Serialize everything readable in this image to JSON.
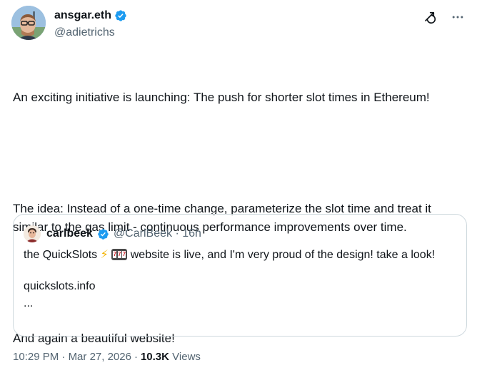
{
  "author": {
    "display_name": "ansgar.eth",
    "handle": "@adietrichs",
    "verified": true,
    "verified_color": "#1d9bf0"
  },
  "actions": {
    "grok_icon": "grok-icon",
    "more_icon": "more-icon"
  },
  "tweet": {
    "paragraphs": [
      "An exciting initiative is launching: The push for shorter slot times in Ethereum!",
      "The idea: Instead of a one-time change, parameterize the slot time and treat it similar to the gas limit - continuous performance improvements over time.",
      "And again a beautiful website!"
    ]
  },
  "quote": {
    "display_name": "carlbeek",
    "handle": "@CarlBeek",
    "separator": "·",
    "time": "16h",
    "verified": true,
    "text_before_emoji": "the QuickSlots ",
    "emoji_bolt": "⚡",
    "text_after_emoji": " website is live, and I'm very proud of the design! take a look!",
    "link": "quickslots.info",
    "ellipsis": "..."
  },
  "meta": {
    "time": "10:29 PM",
    "separator1": "·",
    "date": "Mar 27, 2026",
    "separator2": "·",
    "views_count": "10.3K",
    "views_label": "Views"
  },
  "colors": {
    "text_primary": "#0f1419",
    "text_secondary": "#536471",
    "border": "#cfd9de",
    "verified": "#1d9bf0"
  }
}
